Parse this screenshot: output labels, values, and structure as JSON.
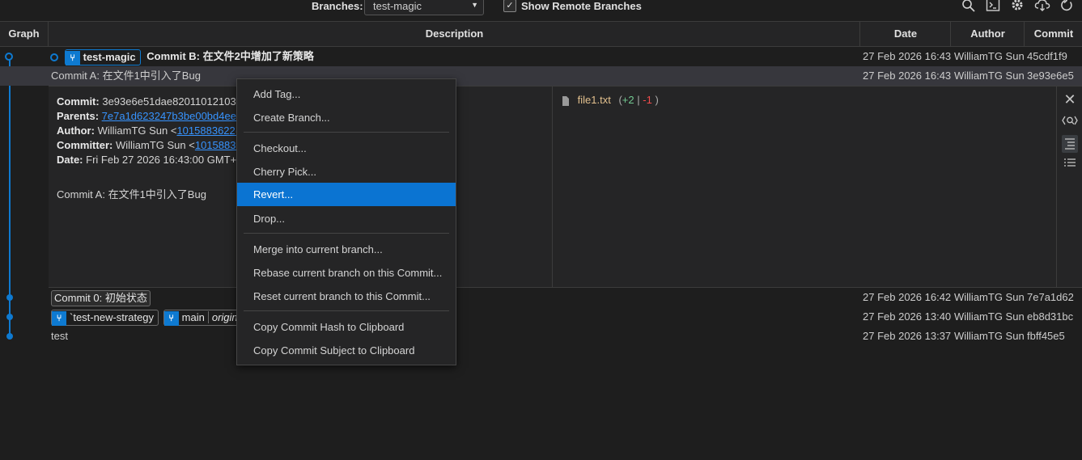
{
  "toolbar": {
    "branches_label": "Branches:",
    "branch_selected": "test-magic",
    "show_remote_checked": true,
    "show_remote_label": "Show Remote Branches",
    "icons": [
      "search-icon",
      "terminal-icon",
      "gear-icon",
      "cloud-fetch-icon",
      "refresh-icon"
    ]
  },
  "columns": {
    "graph": "Graph",
    "description": "Description",
    "date": "Date",
    "author": "Author",
    "commit": "Commit"
  },
  "commits": [
    {
      "branch_tag": "test-magic",
      "description": "Commit B: 在文件2中增加了新策略",
      "date": "27 Feb 2026 16:43",
      "author": "WilliamTG Sun",
      "hash": "45cdf1f9"
    },
    {
      "description": "Commit A: 在文件1中引入了Bug",
      "date": "27 Feb 2026 16:43",
      "author": "WilliamTG Sun",
      "hash": "3e93e6e5"
    },
    {
      "description": "Commit 0: 初始状态",
      "date": "27 Feb 2026 16:42",
      "author": "WilliamTG Sun",
      "hash": "7e7a1d62"
    },
    {
      "branch_tag": "`test-new-strategy",
      "branch_tag2": "main",
      "branch_tag2_remote": "origin",
      "date": "27 Feb 2026 13:40",
      "author": "WilliamTG Sun",
      "hash": "eb8d31bc"
    },
    {
      "description": "test",
      "date": "27 Feb 2026 13:37",
      "author": "WilliamTG Sun",
      "hash": "fbff45e5"
    }
  ],
  "detail": {
    "commit_label": "Commit:",
    "commit_value": "3e93e6e51dae820110121038",
    "parents_label": "Parents:",
    "parents_value": "7e7a1d623247b3be00bd4ee7",
    "author_label": "Author:",
    "author_value": "WilliamTG Sun <",
    "author_email": "1015883622@",
    "committer_label": "Committer:",
    "committer_value": "WilliamTG Sun <",
    "committer_email": "10158836",
    "date_label": "Date:",
    "date_value": "Fri Feb 27 2026 16:43:00 GMT+0",
    "message": "Commit A: 在文件1中引入了Bug",
    "file_name": "file1.txt",
    "file_open": "(",
    "file_add": "+2",
    "file_sep": "|",
    "file_del": "-1",
    "file_close": ")"
  },
  "context_menu": {
    "items": [
      "Add Tag...",
      "Create Branch...",
      "Checkout...",
      "Cherry Pick...",
      "Revert...",
      "Drop...",
      "Merge into current branch...",
      "Rebase current branch on this Commit...",
      "Reset current branch to this Commit...",
      "Copy Commit Hash to Clipboard",
      "Copy Commit Subject to Clipboard"
    ],
    "selected": "Revert..."
  },
  "colors": {
    "accent": "#0e7ad1",
    "selected_menu": "#0b74d2",
    "add": "#73c991",
    "del": "#f14c4c",
    "file": "#e2c08d"
  }
}
